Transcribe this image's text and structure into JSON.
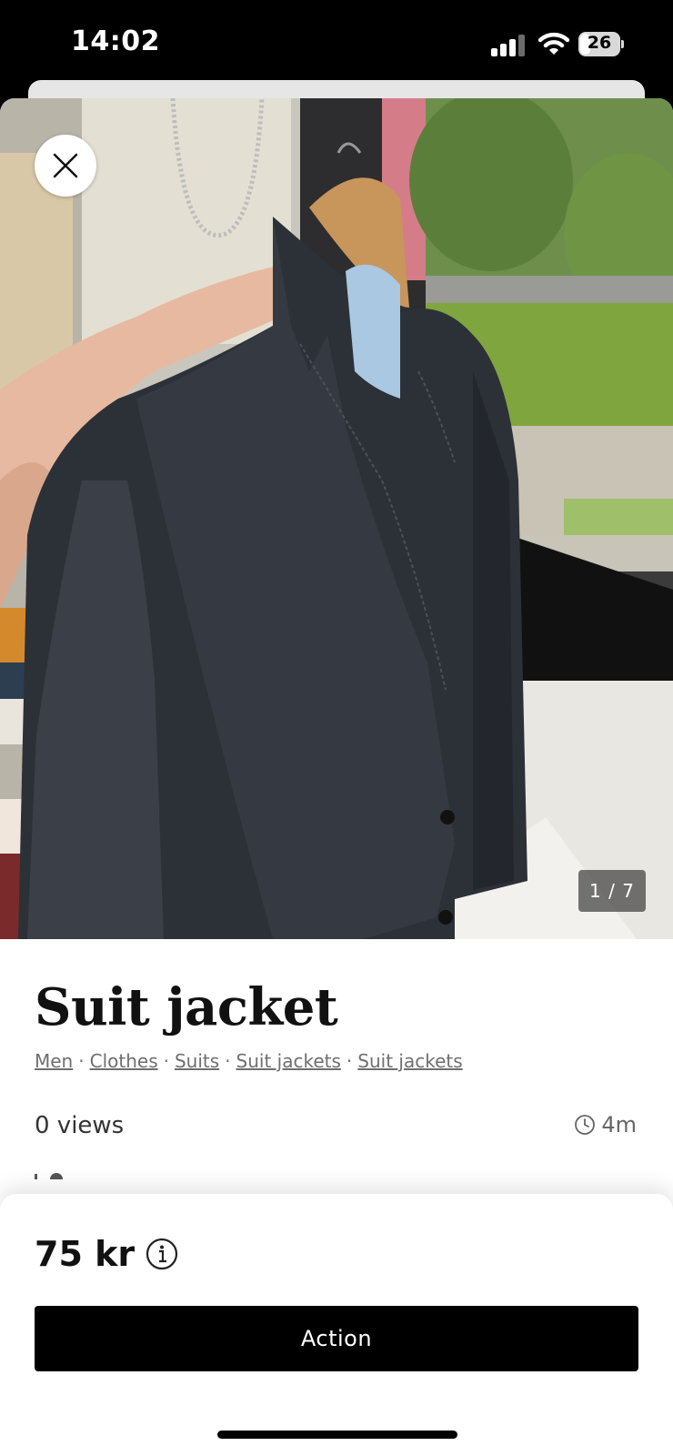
{
  "status_bar": {
    "time": "14:02",
    "battery": "26",
    "battery_level": 0.26
  },
  "photo": {
    "counter": "1 / 7",
    "description_icon": "close-icon"
  },
  "listing": {
    "title": "Suit jacket",
    "breadcrumb": [
      "Men",
      "Clothes",
      "Suits",
      "Suit jackets",
      "Suit jackets"
    ],
    "views": "0 views",
    "time_ago": "4m"
  },
  "bottom_sheet": {
    "price": "75 kr",
    "action_label": "Action"
  },
  "colors": {
    "background": "#000000",
    "card": "#ffffff",
    "button": "#000000",
    "link": "#6f6f6f"
  }
}
